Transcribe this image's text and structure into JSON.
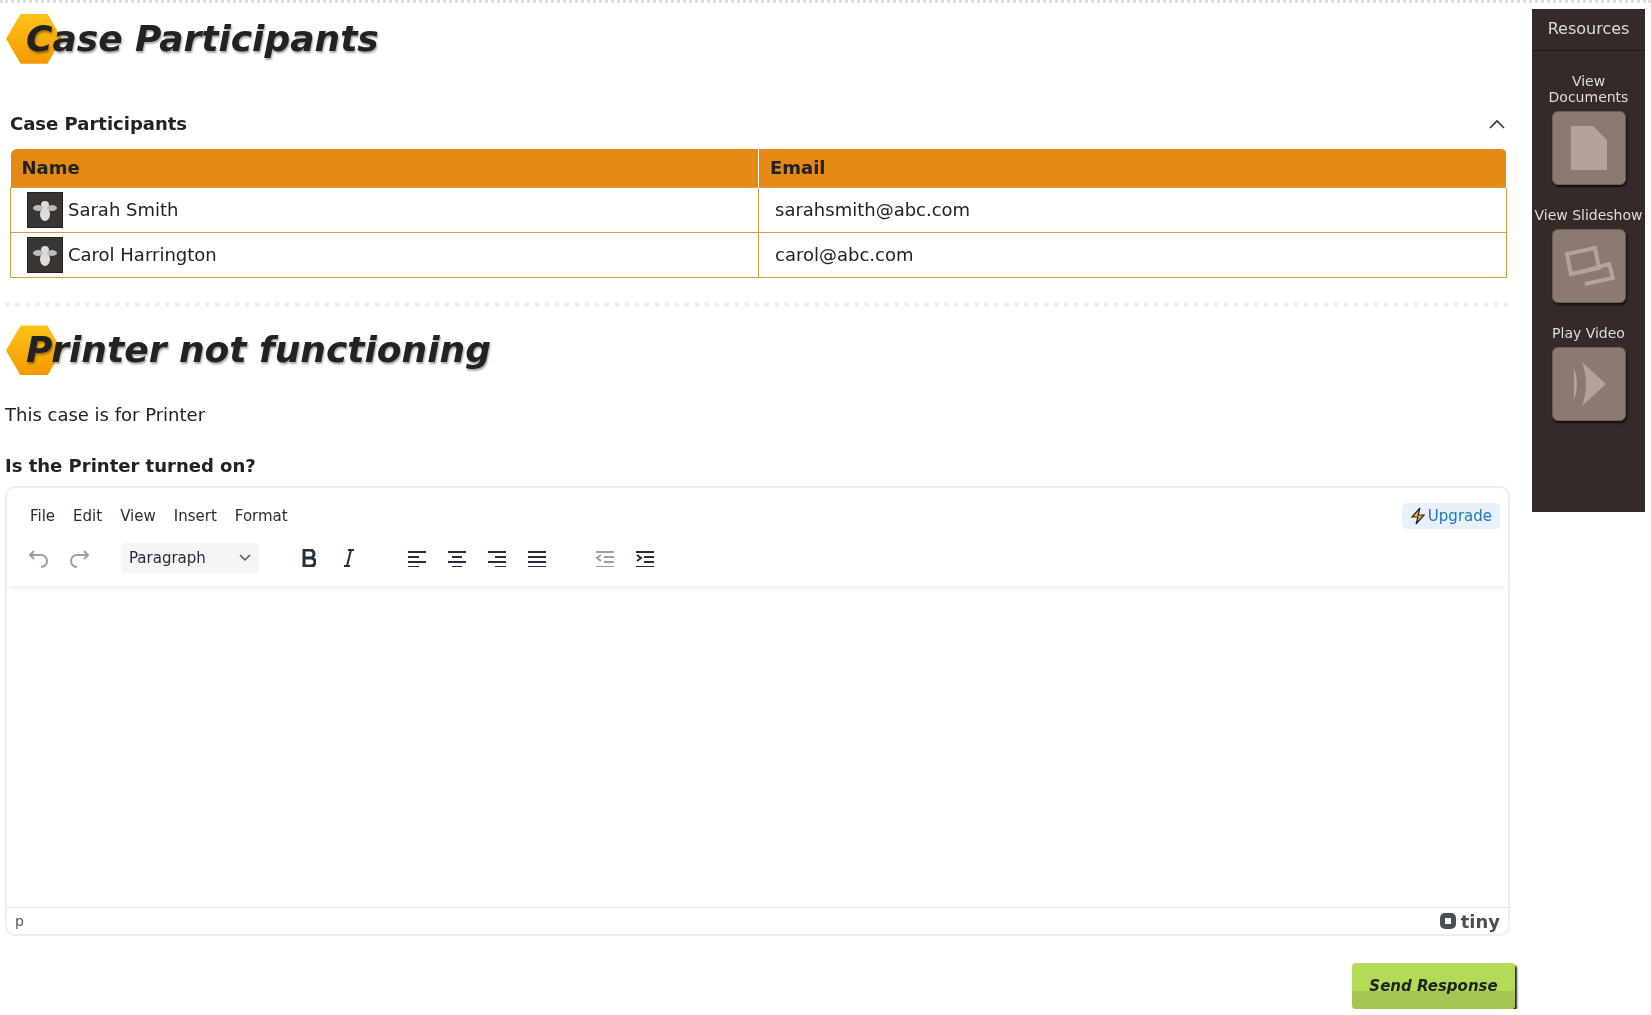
{
  "page_title": "Case Participants",
  "participants_section": {
    "title": "Case Participants",
    "expanded": true,
    "columns": [
      "Name",
      "Email"
    ],
    "rows": [
      {
        "name": "Sarah Smith",
        "email": "sarahsmith@abc.com"
      },
      {
        "name": "Carol Harrington",
        "email": "carol@abc.com"
      }
    ]
  },
  "case": {
    "title": "Printer not functioning",
    "description": "This case is for Printer",
    "question": "Is the Printer turned on?"
  },
  "editor": {
    "menu": [
      "File",
      "Edit",
      "View",
      "Insert",
      "Format"
    ],
    "upgrade": "Upgrade",
    "block_format": "Paragraph",
    "toolbar": [
      {
        "kind": "undo",
        "disabled": true
      },
      {
        "kind": "redo",
        "disabled": true
      },
      {
        "kind": "format"
      },
      {
        "kind": "bold",
        "disabled": false
      },
      {
        "kind": "italic",
        "disabled": false
      },
      {
        "kind": "align-left",
        "disabled": false
      },
      {
        "kind": "align-center",
        "disabled": false
      },
      {
        "kind": "align-right",
        "disabled": false
      },
      {
        "kind": "justify",
        "disabled": false
      },
      {
        "kind": "outdent",
        "disabled": true
      },
      {
        "kind": "indent",
        "disabled": false
      }
    ],
    "path": "p",
    "brand": "tiny"
  },
  "submit_button": "Send Response",
  "sidebar": {
    "title": "Resources",
    "items": [
      {
        "label": "View Documents",
        "kind": "document"
      },
      {
        "label": "View Slideshow",
        "kind": "slideshow"
      },
      {
        "label": "Play Video",
        "kind": "video"
      }
    ]
  }
}
